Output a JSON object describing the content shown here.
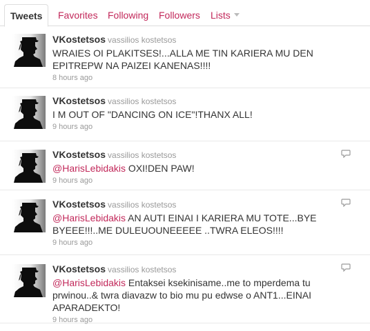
{
  "tabs": [
    {
      "label": "Tweets"
    },
    {
      "label": "Favorites"
    },
    {
      "label": "Following"
    },
    {
      "label": "Followers"
    },
    {
      "label": "Lists"
    }
  ],
  "tweets": [
    {
      "screen_name": "VKostetsos",
      "full_name": "vassilios kostetsos",
      "mention": "",
      "text": "WRAIES OI PLAKITSES!...ALLA ME TIN KARIERA MU DEN EPITREPW NA PAIZEI KANENAS!!!!",
      "time": "8 hours ago",
      "has_reply_icon": false
    },
    {
      "screen_name": "VKostetsos",
      "full_name": "vassilios kostetsos",
      "mention": "",
      "text": "I M OUT OF \"DANCING ON ICE\"!THANX ALL!",
      "time": "9 hours ago",
      "has_reply_icon": false
    },
    {
      "screen_name": "VKostetsos",
      "full_name": "vassilios kostetsos",
      "mention": "@HarisLebidakis",
      "text": " OXI!DEN PAW!",
      "time": "9 hours ago",
      "has_reply_icon": true
    },
    {
      "screen_name": "VKostetsos",
      "full_name": "vassilios kostetsos",
      "mention": "@HarisLebidakis",
      "text": " AN AUTI EINAI I KARIERA MU TOTE...BYE BYEEE!!!..ME DULEUOUNEEEEE ..TWRA ELEOS!!!!",
      "time": "9 hours ago",
      "has_reply_icon": true
    },
    {
      "screen_name": "VKostetsos",
      "full_name": "vassilios kostetsos",
      "mention": "@HarisLebidakis",
      "text": " Entaksei ksekinisame..me to mperdema tu prwinou..& twra diavazw to bio mu pu edwse o ANT1...EINAI APARADEKTO!",
      "time": "9 hours ago",
      "has_reply_icon": true
    }
  ],
  "colors": {
    "link": "#c2285a",
    "meta": "#999999",
    "text": "#333333",
    "divider": "#e8e8e8"
  }
}
